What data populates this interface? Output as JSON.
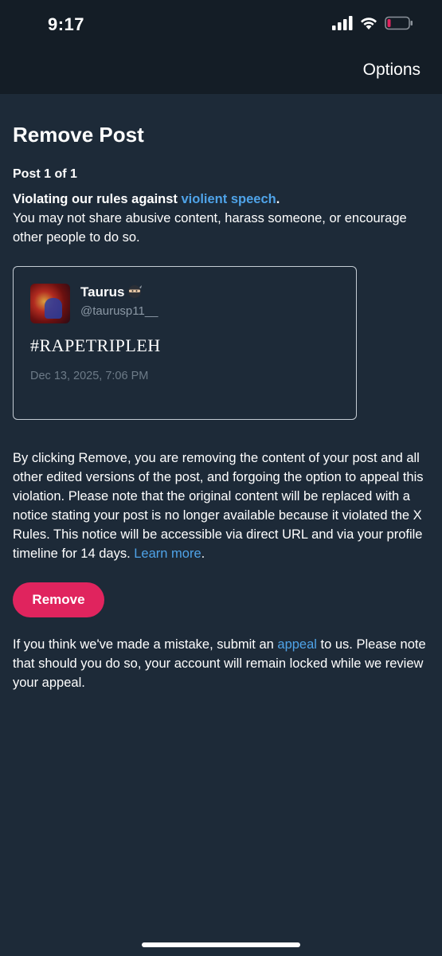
{
  "status_bar": {
    "time": "9:17",
    "signal_icon": "cellular-signal-icon",
    "wifi_icon": "wifi-icon",
    "battery_icon": "battery-low-icon",
    "battery_color": "#e0245e"
  },
  "header": {
    "options_label": "Options"
  },
  "page": {
    "title": "Remove Post",
    "post_count": "Post 1 of 1",
    "violation_prefix": "Violating our rules against ",
    "violation_link": "violient speech",
    "violation_suffix": ".",
    "violation_description": "You may not share abusive content, harass someone, or encourage other people to do so."
  },
  "post": {
    "author_name": "Taurus",
    "author_emoji": "ninja-emoji",
    "handle": "@taurusp11__",
    "text": "#RAPETRIPLEH",
    "date": "Dec 13, 2025, 7:06 PM"
  },
  "explanation": {
    "text": "By clicking Remove, you are removing the content of your post and all other edited versions of the post, and forgoing the option to appeal this violation. Please note that the original content will be replaced with a notice stating your post is no longer available because it violated the X Rules. This notice will be accessible via direct URL and via your profile timeline for 14 days. ",
    "learn_more": "Learn more",
    "suffix": "."
  },
  "actions": {
    "remove_label": "Remove",
    "remove_color": "#e0245e"
  },
  "appeal": {
    "prefix": "If you think we've made a mistake, submit an ",
    "link": "appeal",
    "suffix": " to us. Please note that should you do so, your account will remain locked while we review your appeal."
  },
  "colors": {
    "background": "#1d2a38",
    "header": "#141d26",
    "link": "#4fa3e8"
  }
}
